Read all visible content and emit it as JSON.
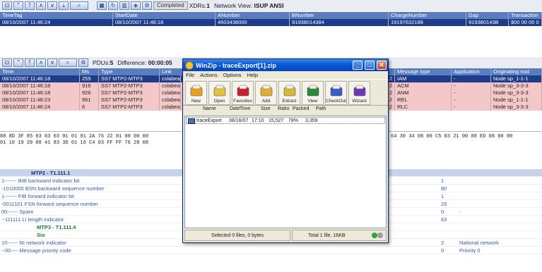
{
  "top_toolbar": {
    "completed_label": "Completed",
    "xdrs_label": "XDRs:",
    "xdrs_value": "1",
    "network_label": "Network View:",
    "network_value": "ISUP ANSI"
  },
  "xdr_table": {
    "columns": [
      "TimeTag",
      "StartDate",
      "ANumber",
      "BNumber",
      "ChargeNumber",
      "Gap",
      "Transaction"
    ],
    "row": [
      "08/10/2007 11:46:24",
      "08/10/2007 11:46:18",
      "4603438000",
      "91938014384",
      "19197632188",
      "919380143B",
      "$00 00 00 0"
    ]
  },
  "pdu_toolbar": {
    "pdus_label": "PDUs:",
    "pdus_value": "5",
    "difference_label": "Difference:",
    "difference_value": "00:00:05"
  },
  "pdu_table": {
    "columns": [
      "Time",
      "Ms",
      "Type",
      "Link",
      "Message type",
      "Application",
      "Originating nod"
    ],
    "rows": [
      {
        "time": "08/10/2007 11:46:18",
        "ms": "259",
        "type": "SS7 MTP2-MTP3",
        "link": "cslabea",
        "num": "2",
        "msg": "IAM",
        "app": "-",
        "orig": "Node sp_1-1-1"
      },
      {
        "time": "08/10/2007 11:46:18",
        "ms": "916",
        "type": "SS7 MTP2-MTP3",
        "link": "cslabea",
        "num": "2",
        "msg": "ACM",
        "app": "-",
        "orig": "Node sp_3-3-3"
      },
      {
        "time": "08/10/2007 11:46:18",
        "ms": "926",
        "type": "SS7 MTP2-MTP3",
        "link": "cslabea",
        "num": "2",
        "msg": "ANM",
        "app": "-",
        "orig": "Node sp_3-3-3"
      },
      {
        "time": "08/10/2007 11:46:23",
        "ms": "951",
        "type": "SS7 MTP2-MTP3",
        "link": "cslabea",
        "num": "2",
        "msg": "REL",
        "app": "-",
        "orig": "Node sp_1-1-1"
      },
      {
        "time": "08/10/2007 11:46:24",
        "ms": "6",
        "type": "SS7 MTP2-MTP3",
        "link": "cslabea",
        "num": "2",
        "msg": "RLC",
        "app": "-",
        "orig": "Node sp_3-3-3"
      }
    ]
  },
  "hex_dump": {
    "line1_left": "80 8D 3F 85 03 03 03 01 01 01 2A 76 22 01 00 00 00",
    "line2_left": "01 10 19 39 08 41 83 3D 01 16 C4 03 FF FF 76 28 08",
    "line1_right": "64 30 34 08 00 C5 03 21 00 08 ED 08 00 00"
  },
  "decode_tree": [
    {
      "kind": "hdr",
      "text": "MTP2 - T1.111.1",
      "val": "",
      "desc": ""
    },
    {
      "kind": "line",
      "text": "1------- BIB backward indicator bit",
      "val": "1",
      "desc": ""
    },
    {
      "kind": "line",
      "text": "-1010000 BSN backward sequence number",
      "val": "80",
      "desc": ""
    },
    {
      "kind": "line",
      "text": "1------- FIB forward indicator bit",
      "val": "1",
      "desc": ""
    },
    {
      "kind": "line",
      "text": "-0011101 FSN forward sequence number",
      "val": "29",
      "desc": ""
    },
    {
      "kind": "line",
      "text": "00------ Spare",
      "val": "0",
      "desc": "-"
    },
    {
      "kind": "line",
      "text": "--111111 LI length indicator",
      "val": "63",
      "desc": ""
    },
    {
      "kind": "sub",
      "text": "MTP3 - T1.111.4",
      "val": "",
      "desc": ""
    },
    {
      "kind": "sub",
      "text": "Sio",
      "val": "",
      "desc": ""
    },
    {
      "kind": "line",
      "text": "10------ NI network indicator",
      "val": "2",
      "desc": "National network"
    },
    {
      "kind": "line",
      "text": "--00---- Message priority code",
      "val": "0",
      "desc": "Priority 0"
    }
  ],
  "winzip": {
    "title": "WinZip - traceExport[1].zip",
    "menu": [
      "File",
      "Actions",
      "Options",
      "Help"
    ],
    "tools": [
      {
        "label": "New",
        "icon": "new-archive-icon",
        "color": "#e8a21a"
      },
      {
        "label": "Open",
        "icon": "open-folder-icon",
        "color": "#e6c23a"
      },
      {
        "label": "Favorites",
        "icon": "favorites-heart-icon",
        "color": "#c8202c"
      },
      {
        "label": "Add",
        "icon": "add-files-icon",
        "color": "#e0b030"
      },
      {
        "label": "Extract",
        "icon": "extract-icon",
        "color": "#d8b83a"
      },
      {
        "label": "View",
        "icon": "view-eye-icon",
        "color": "#2a8a3a"
      },
      {
        "label": "CheckOut",
        "icon": "checkout-icon",
        "color": "#3a5cc8"
      },
      {
        "label": "Wizard",
        "icon": "wizard-icon",
        "color": "#6a3ab8"
      }
    ],
    "columns": [
      "Name",
      "Date",
      "Time",
      "Size",
      "Ratio",
      "Packed",
      "Path"
    ],
    "file": {
      "name": "traceExport",
      "date": "08/16/07",
      "time": "17:10",
      "size": "15,527",
      "ratio": "78%",
      "packed": "3,359",
      "path": ""
    },
    "status_left": "Selected 0 files, 0 bytes",
    "status_right": "Total 1 file, 16KB"
  }
}
